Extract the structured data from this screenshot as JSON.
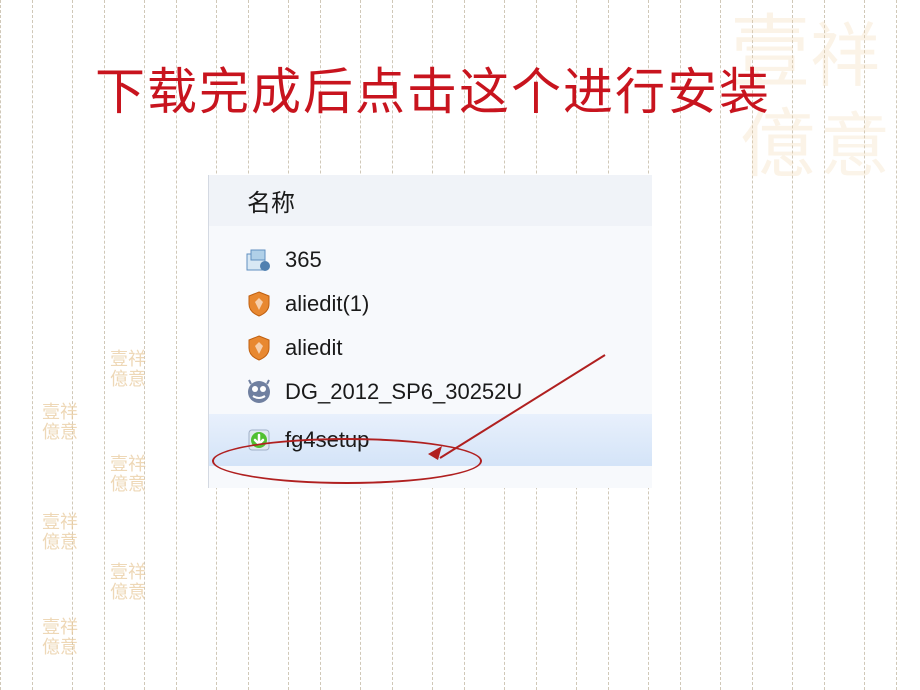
{
  "title": "下载完成后点击这个进行安装",
  "explorer": {
    "column_header": "名称",
    "files": [
      {
        "name": "365",
        "icon": "installer-blue"
      },
      {
        "name": "aliedit(1)",
        "icon": "shield-orange"
      },
      {
        "name": "aliedit",
        "icon": "shield-orange"
      },
      {
        "name": "DG_2012_SP6_30252U",
        "icon": "app-gray"
      },
      {
        "name": "fg4setup",
        "icon": "download-green"
      }
    ]
  },
  "seal_char": "壹祥億"
}
